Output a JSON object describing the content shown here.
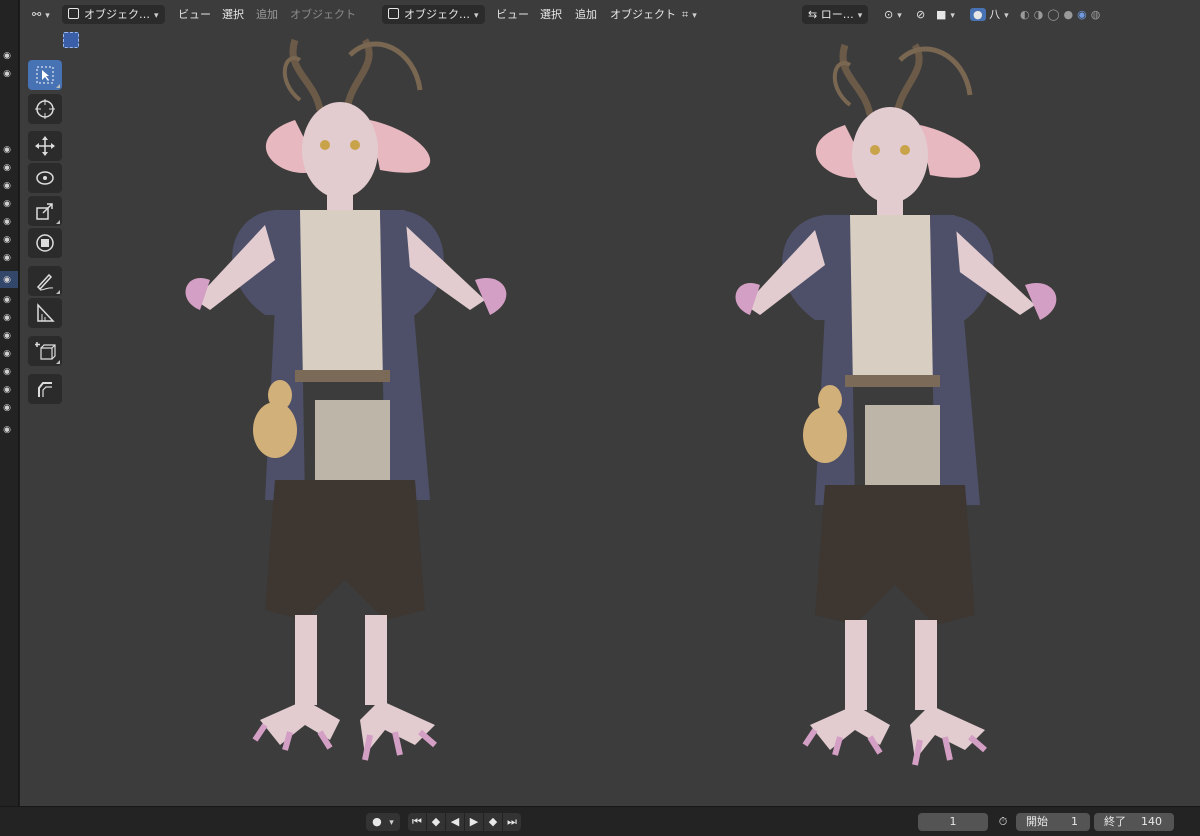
{
  "header": {
    "mode_label": "オブジェク…",
    "menu": [
      "ビュー",
      "選択",
      "追加",
      "オブジェクト"
    ],
    "second_mode_label": "オブジェク…",
    "second_menu": [
      "ビュー",
      "選択",
      "追加",
      "オブジェクト"
    ],
    "orientation_label": "ロー…",
    "shading_label": "八"
  },
  "toolbar": {
    "tools": [
      "select-box",
      "cursor",
      "move",
      "rotate",
      "scale",
      "transform",
      "annotate",
      "measure",
      "add-cube",
      "edit-bevel"
    ]
  },
  "timeline": {
    "current_frame": "1",
    "start_label": "開始",
    "start_value": "1",
    "end_label": "終了",
    "end_value": "140"
  },
  "colors": {
    "viewport_bg": "#3c3c3c",
    "active_tool": "#4772b3",
    "robe": "#4d5068",
    "skin": "#e2ccd0",
    "pants": "#3d3631"
  }
}
